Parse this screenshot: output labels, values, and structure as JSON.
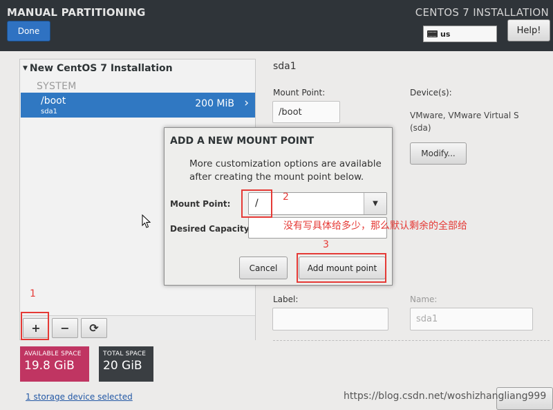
{
  "header": {
    "title": "MANUAL PARTITIONING",
    "done_label": "Done",
    "install_title": "CENTOS 7 INSTALLATION",
    "keyboard_layout": "us",
    "help_label": "Help!"
  },
  "left_panel": {
    "section_title": "New CentOS 7 Installation",
    "group_label": "SYSTEM",
    "partitions": [
      {
        "mount": "/boot",
        "device": "sda1",
        "size": "200 MiB",
        "selected": true
      }
    ],
    "toolbar": {
      "add": "+",
      "remove": "−",
      "refresh": "⟳"
    }
  },
  "space": {
    "available_label": "AVAILABLE SPACE",
    "available_value": "19.8 GiB",
    "total_label": "TOTAL SPACE",
    "total_value": "20 GiB",
    "available_color": "#c03562",
    "total_color": "#3a3e42"
  },
  "storage_link": "1 storage device selected",
  "details": {
    "device_title": "sda1",
    "mount_point_label": "Mount Point:",
    "mount_point_value": "/boot",
    "devices_label": "Device(s):",
    "devices_line1": "VMware, VMware Virtual S",
    "devices_line2": "(sda)",
    "modify_label": "Modify...",
    "label_label": "Label:",
    "label_value": "",
    "name_label": "Name:",
    "name_value": "sda1"
  },
  "dialog": {
    "title": "ADD A NEW MOUNT POINT",
    "description": "More customization options are available after creating the mount point below.",
    "mount_point_label": "Mount Point:",
    "mount_point_value": "/",
    "capacity_label": "Desired Capacity:",
    "capacity_value": "",
    "cancel_label": "Cancel",
    "add_label": "Add mount point"
  },
  "annotations": {
    "step1": "1",
    "step2": "2",
    "step3": "3",
    "note": "没有写具体给多少，那么默认剩余的全部给"
  },
  "watermark": "https://blog.csdn.net/woshizhangliang999",
  "colors": {
    "header_bg": "#2f3439",
    "accent_blue": "#3078c2",
    "annotation_red": "#e53935"
  }
}
